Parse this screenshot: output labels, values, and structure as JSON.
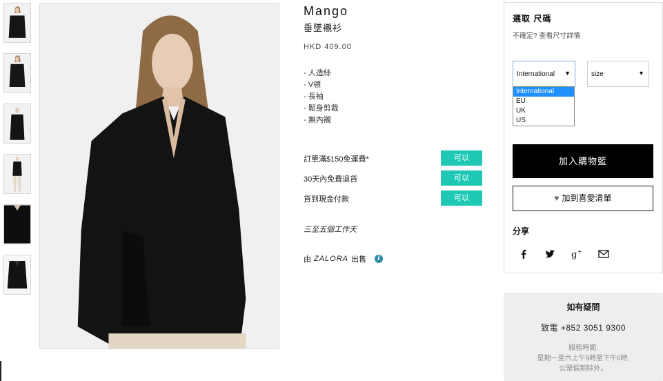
{
  "product": {
    "brand": "Mango",
    "name": "垂墜襯衫",
    "price": "HKD 409.00",
    "features": [
      "- 人造絲",
      "- V領",
      "- 長袖",
      "- 鬆身剪裁",
      "- 無內襯"
    ]
  },
  "services": [
    {
      "label": "訂單滿$150免運費*",
      "status": "可以"
    },
    {
      "label": "30天內免費退貨",
      "status": "可以"
    },
    {
      "label": "貨到現金付款",
      "status": "可以"
    }
  ],
  "delivery": "三至五個工作天",
  "seller": {
    "prefix": "由",
    "name": "ZALORA",
    "suffix": "出售",
    "info_icon": "i"
  },
  "size_panel": {
    "title": "選取 尺碼",
    "hint": "不確定? 查看尺寸詳情",
    "system_select": {
      "value": "International",
      "caret": "▼",
      "options": [
        "International",
        "EU",
        "UK",
        "US"
      ]
    },
    "size_select": {
      "value": "size",
      "caret": "▼"
    }
  },
  "actions": {
    "add_to_cart": "加入購物籃",
    "wishlist_icon": "♥",
    "wishlist": "加到喜愛清單"
  },
  "share": {
    "title": "分享",
    "icons": [
      "facebook-icon",
      "twitter-icon",
      "google-plus-icon",
      "mail-icon"
    ]
  },
  "help": {
    "title": "如有疑問",
    "phone": "致電 +852 3051 9300",
    "hours_title": "服務時間:",
    "hours_line1": "星期一至六上午9時至下午6時,",
    "hours_line2": "公眾假期除外。"
  },
  "colors": {
    "accent": "#1ec8b4",
    "cart_button": "#000000",
    "info_icon": "#2e8aa8",
    "dropdown_selected": "#1e90ff"
  }
}
